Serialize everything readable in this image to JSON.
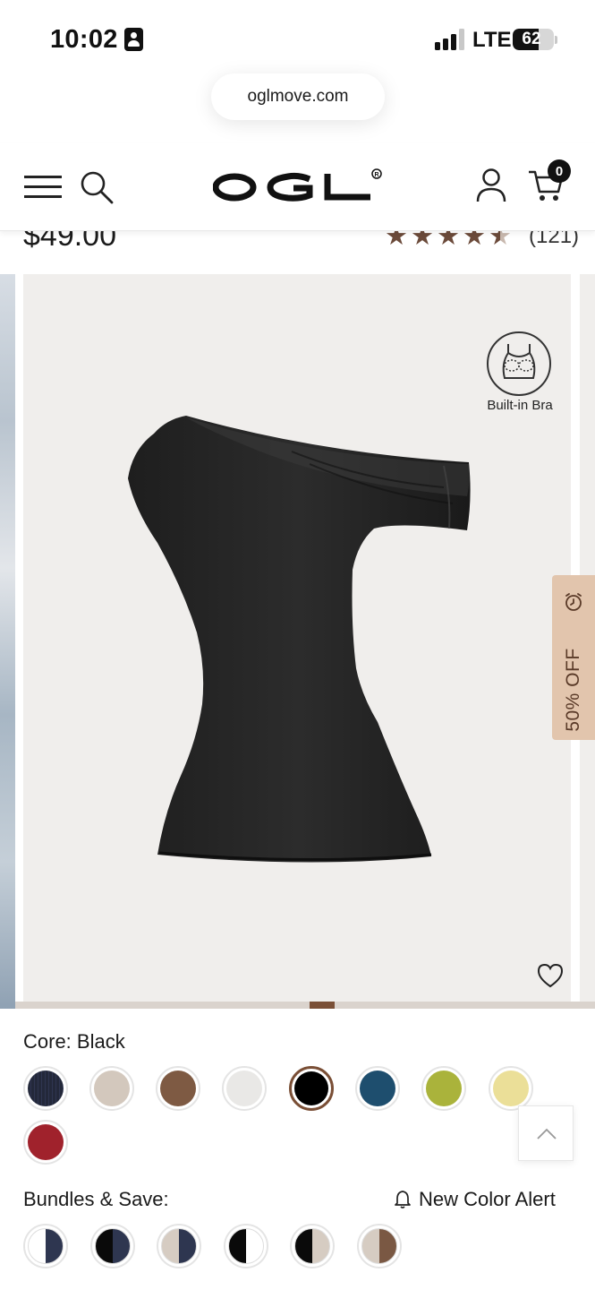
{
  "status_bar": {
    "time": "10:02",
    "network": "LTE",
    "battery": "62",
    "battery_level": 0.62,
    "signal_bars": 3
  },
  "browser": {
    "url": "oglmove.com"
  },
  "header": {
    "logo": "OGL",
    "logo_mark": "®",
    "cart_count": "0"
  },
  "product": {
    "price": "$49.00",
    "rating": 4.5,
    "review_count": "(121)",
    "badge_label": "Built-in Bra",
    "discount_label": "50% OFF",
    "gallery_progress": 0.5
  },
  "colors": {
    "label_prefix": "Core:",
    "selected_name": "Black",
    "swatches": [
      {
        "name": "navy",
        "color": "#23283a",
        "pattern": "ribbed"
      },
      {
        "name": "beige",
        "color": "#d3c8bd"
      },
      {
        "name": "brown",
        "color": "#7e5a43"
      },
      {
        "name": "white",
        "color": "#e9e8e6"
      },
      {
        "name": "black",
        "color": "#000000",
        "selected": true
      },
      {
        "name": "teal-blue",
        "color": "#1e4e6e"
      },
      {
        "name": "olive",
        "color": "#aab33b"
      },
      {
        "name": "butter",
        "color": "#ebdf98"
      },
      {
        "name": "red",
        "color": "#a0222c"
      }
    ]
  },
  "bundles": {
    "label": "Bundles & Save:",
    "alert_label": "New Color Alert",
    "swatches": [
      {
        "left": "#ffffff",
        "right": "#2e3650"
      },
      {
        "left": "#0a0a0a",
        "right": "#2e3650"
      },
      {
        "left": "#d6ccc2",
        "right": "#2e3650"
      },
      {
        "left": "#0a0a0a",
        "right": "#ffffff"
      },
      {
        "left": "#0a0a0a",
        "right": "#d6ccc2"
      },
      {
        "left": "#d6ccc2",
        "right": "#7a5843"
      }
    ]
  },
  "colors_theme": {
    "accent": "#7a4f36",
    "star": "#6b4a3a",
    "discount_bg": "#e2c5ad"
  }
}
